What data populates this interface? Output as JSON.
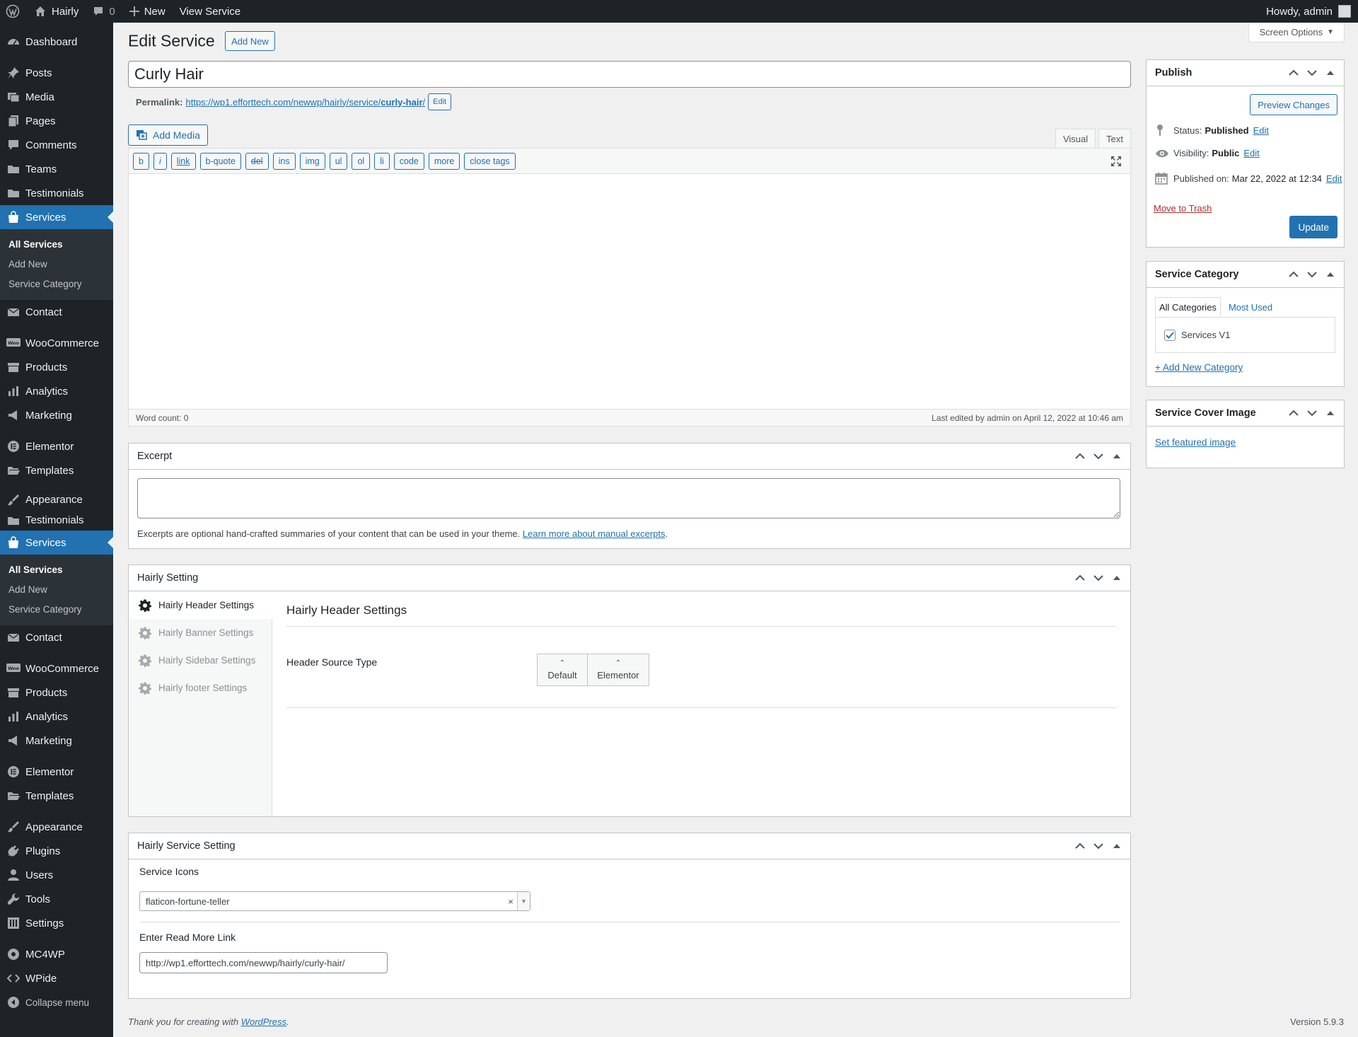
{
  "adminbar": {
    "site_name": "Hairly",
    "comments_count": "0",
    "new_label": "New",
    "view_label": "View Service",
    "howdy": "Howdy, admin"
  },
  "sidebar": {
    "dashboard": "Dashboard",
    "group1": {
      "posts": "Posts",
      "media": "Media",
      "pages": "Pages",
      "comments": "Comments",
      "teams": "Teams",
      "testimonials": "Testimonials",
      "services": "Services",
      "sub_all": "All Services",
      "sub_add": "Add New",
      "sub_cat": "Service Category",
      "contact": "Contact",
      "woocommerce": "WooCommerce",
      "products": "Products",
      "analytics": "Analytics",
      "marketing": "Marketing",
      "elementor": "Elementor",
      "templates": "Templates"
    },
    "group2": {
      "appearance": "Appearance",
      "testimonials": "Testimonials",
      "services": "Services",
      "sub_all": "All Services",
      "sub_add": "Add New",
      "sub_cat": "Service Category",
      "contact": "Contact",
      "woocommerce": "WooCommerce",
      "products": "Products",
      "analytics": "Analytics",
      "marketing": "Marketing",
      "elementor": "Elementor",
      "templates": "Templates"
    },
    "group3": {
      "appearance": "Appearance",
      "plugins": "Plugins",
      "users": "Users",
      "tools": "Tools",
      "settings": "Settings",
      "mc4wp": "MC4WP",
      "wpide": "WPide",
      "collapse": "Collapse menu"
    }
  },
  "header": {
    "title": "Edit Service",
    "add_new": "Add New",
    "screen_options": "Screen Options"
  },
  "post": {
    "title_value": "Curly Hair",
    "permalink_label": "Permalink:",
    "permalink_base": "https://wp1.efforttech.com/newwp/hairly/service/",
    "permalink_slug": "curly-hair",
    "permalink_tail": "/",
    "permalink_edit": "Edit"
  },
  "editor": {
    "add_media": "Add Media",
    "tab_visual": "Visual",
    "tab_text": "Text",
    "buttons": [
      "b",
      "i",
      "link",
      "b-quote",
      "del",
      "ins",
      "img",
      "ul",
      "ol",
      "li",
      "code",
      "more",
      "close tags"
    ],
    "word_count": "Word count: 0",
    "last_edited": "Last edited by admin on April 12, 2022 at 10:46 am"
  },
  "excerpt": {
    "title": "Excerpt",
    "help": "Excerpts are optional hand-crafted summaries of your content that can be used in your theme.",
    "learn_more": "Learn more about manual excerpts",
    "period": "."
  },
  "hairly_setting": {
    "title": "Hairly Setting",
    "tabs": [
      "Hairly Header Settings",
      "Hairly Banner Settings",
      "Hairly Sidebar Settings",
      "Hairly footer Settings"
    ],
    "panel_title": "Hairly Header Settings",
    "field_label": "Header Source Type",
    "options": [
      "Default",
      "Elementor"
    ]
  },
  "service_setting": {
    "title": "Hairly Service Setting",
    "icons_label": "Service Icons",
    "icons_value": "flaticon-fortune-teller",
    "readmore_label": "Enter Read More Link",
    "readmore_value": "http://wp1.efforttech.com/newwp/hairly/curly-hair/"
  },
  "publish": {
    "title": "Publish",
    "preview": "Preview Changes",
    "status_label": "Status:",
    "status_value": "Published",
    "visibility_label": "Visibility:",
    "visibility_value": "Public",
    "published_label": "Published on:",
    "published_value": "Mar 22, 2022 at 12:34",
    "edit": "Edit",
    "trash": "Move to Trash",
    "update": "Update"
  },
  "category": {
    "title": "Service Category",
    "tab_all": "All Categories",
    "tab_most": "Most Used",
    "item": "Services V1",
    "add_new": "+ Add New Category"
  },
  "cover": {
    "title": "Service Cover Image",
    "set_link": "Set featured image"
  },
  "footer": {
    "thanks": "Thank you for creating with",
    "wordpress": "WordPress",
    "period": ".",
    "version": "Version 5.9.3"
  }
}
